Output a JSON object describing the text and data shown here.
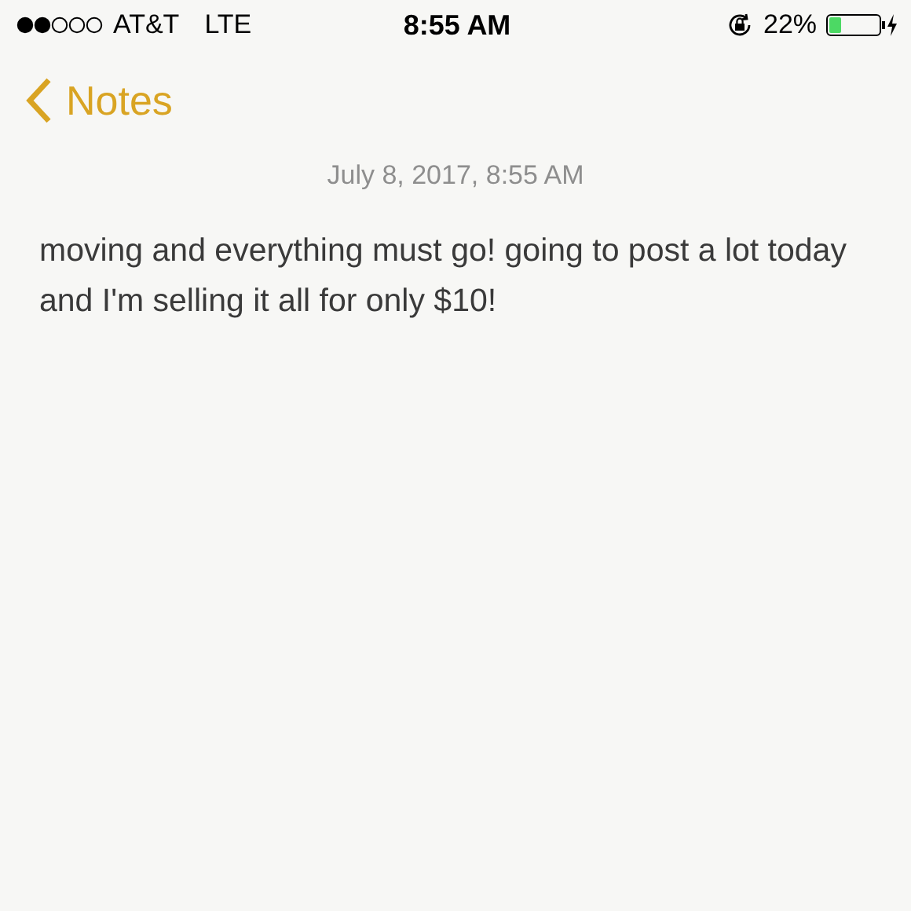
{
  "status_bar": {
    "carrier": "AT&T",
    "network": "LTE",
    "time": "8:55 AM",
    "battery_percent": "22%"
  },
  "nav": {
    "back_label": "Notes"
  },
  "note": {
    "date": "July 8, 2017, 8:55 AM",
    "body": "moving and everything must go! going to post a lot today and I'm selling it all for only $10!"
  }
}
